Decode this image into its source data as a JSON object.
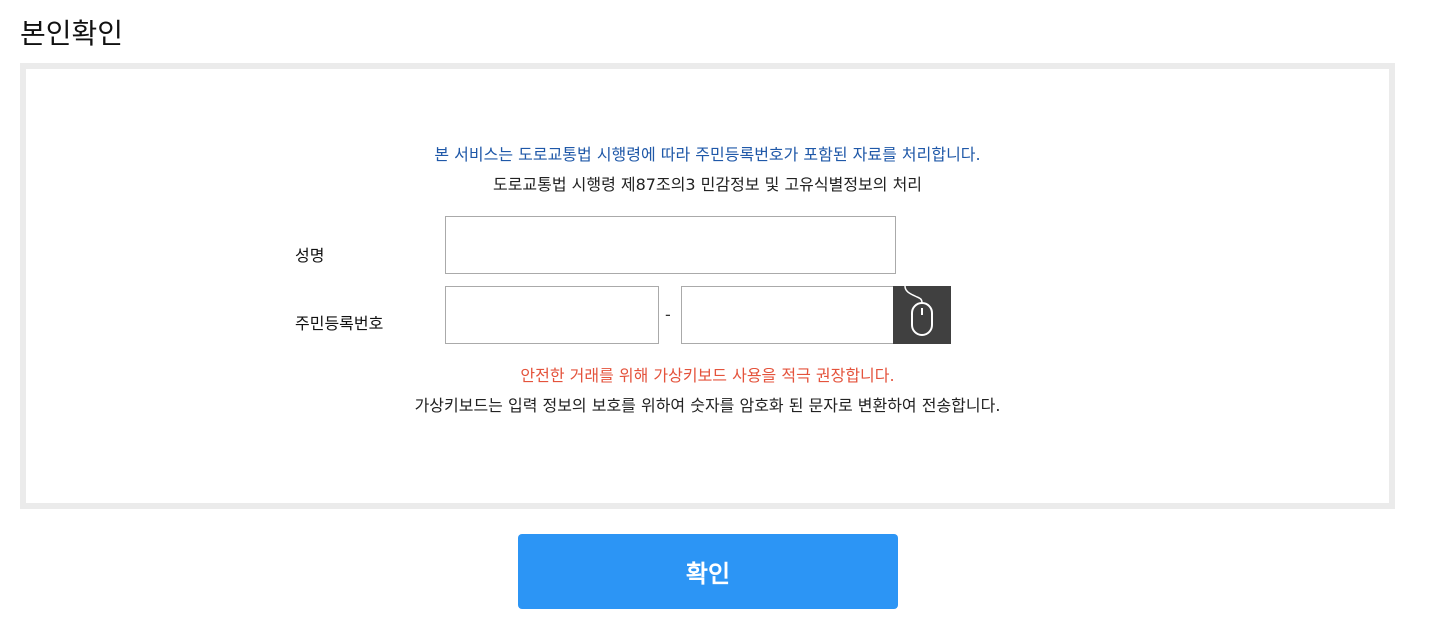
{
  "page": {
    "title": "본인확인"
  },
  "notice": {
    "line1": "본 서비스는 도로교통법 시행령에 따라 주민등록번호가 포함된 자료를 처리합니다.",
    "line2": "도로교통법 시행령 제87조의3 민감정보 및 고유식별정보의 처리"
  },
  "form": {
    "name_label": "성명",
    "name_value": "",
    "rrn_label": "주민등록번호",
    "rrn_front_value": "",
    "rrn_back_value": "",
    "rrn_separator": "-",
    "virtual_keyboard_icon": "mouse-icon"
  },
  "warning": {
    "line1": "안전한 거래를 위해 가상키보드 사용을 적극 권장합니다.",
    "line2": "가상키보드는 입력 정보의 보호를 위하여 숫자를 암호화 된 문자로 변환하여 전송합니다."
  },
  "actions": {
    "confirm_label": "확인"
  },
  "colors": {
    "notice_blue": "#1f58a8",
    "warning_red": "#e4533c",
    "confirm_button": "#2c95f5",
    "keyboard_button": "#404040",
    "panel_border": "#ebebeb"
  }
}
